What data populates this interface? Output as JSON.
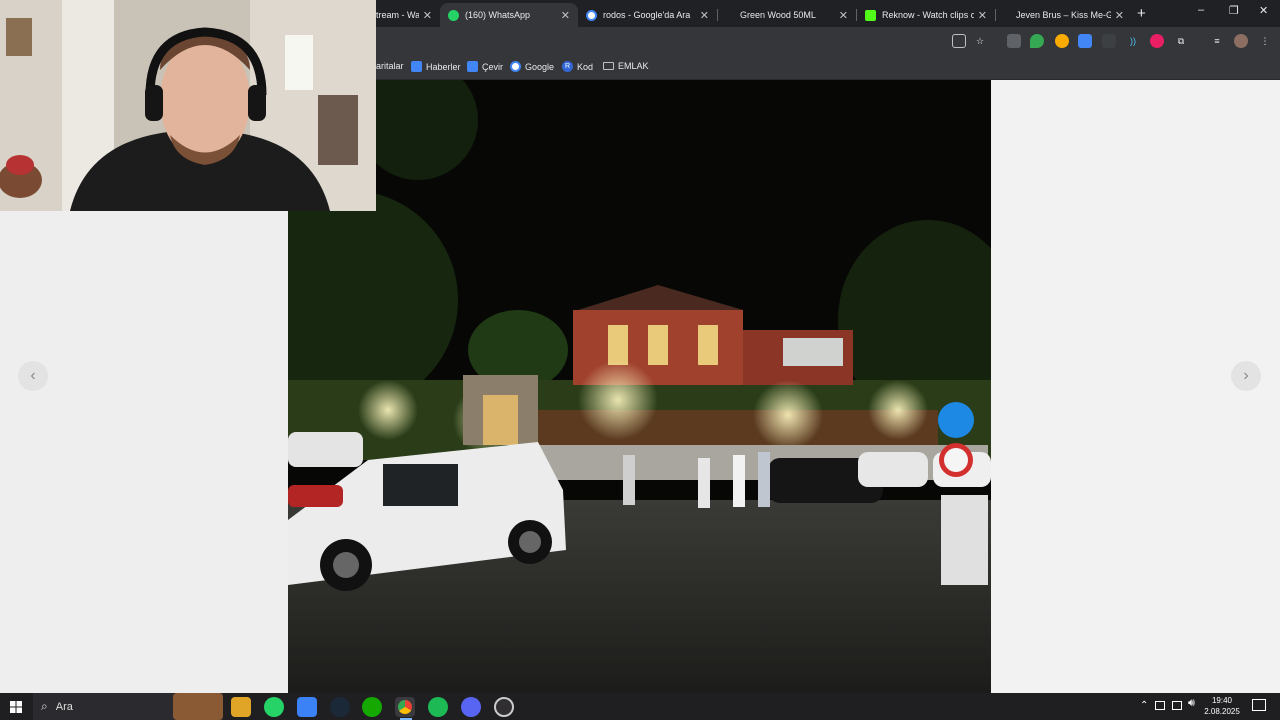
{
  "browser": {
    "tabs": [
      {
        "title": "tream - Wa",
        "favicon": "stream-icon",
        "color": "#5f6368",
        "active": false
      },
      {
        "title": "(160) WhatsApp",
        "favicon": "whatsapp-icon",
        "color": "#25d366",
        "active": true
      },
      {
        "title": "rodos - Google'da Ara",
        "favicon": "google-icon",
        "color": "#ffffff",
        "active": false
      },
      {
        "title": "Green Wood 50ML",
        "favicon": "shop-icon",
        "color": "#202124",
        "active": false
      },
      {
        "title": "Reknow - Watch clips on",
        "favicon": "kick-icon",
        "color": "#53fc18",
        "active": false
      },
      {
        "title": "Jeven Brus – Kiss Me-Girl",
        "favicon": "music-icon",
        "color": "#202124",
        "active": false
      }
    ],
    "new_tab": "+",
    "window_controls": {
      "minimize": "–",
      "restore": "❐",
      "close": "✕"
    },
    "bookmarks": [
      {
        "label": "aritalar",
        "icon": "maps-icon",
        "color": ""
      },
      {
        "label": "Haberler",
        "icon": "news-icon",
        "color": "#4285f4"
      },
      {
        "label": "Çevir",
        "icon": "translate-icon",
        "color": "#4285f4"
      },
      {
        "label": "Google",
        "icon": "google-icon",
        "color": "#ffffff"
      },
      {
        "label": "Kod",
        "icon": "r-icon",
        "color": "#3367d6"
      },
      {
        "label": "EMLAK",
        "icon": "folder-icon",
        "color": ""
      }
    ]
  },
  "page": {
    "prev_arrow": "‹",
    "next_arrow": "›"
  },
  "taskbar": {
    "search_placeholder": "Ara",
    "time": "19:40",
    "date": "2.08.2025",
    "apps": [
      "file-explorer-icon",
      "whatsapp-icon",
      "store-icon",
      "steam-icon",
      "upwork-icon",
      "chrome-icon",
      "spotify-icon",
      "discord-icon",
      "obs-icon"
    ]
  }
}
